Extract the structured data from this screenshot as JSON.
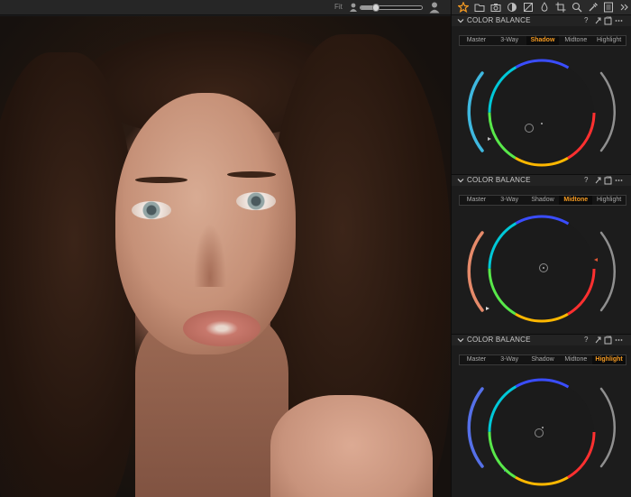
{
  "viewer": {
    "fit_label": "Fit",
    "zoom_level": 0.25,
    "photo": "portrait-woman-curly-hair"
  },
  "toolbar": {
    "icons": [
      "star-icon",
      "folder-icon",
      "camera-icon",
      "circle-half-icon",
      "exposure-icon",
      "crop-icon",
      "search-icon",
      "pipette-icon",
      "list-icon",
      "more-icon"
    ]
  },
  "color_balance_panels": [
    {
      "title": "COLOR BALANCE",
      "tabs": [
        "Master",
        "3-Way",
        "Shadow",
        "Midtone",
        "Highlight"
      ],
      "active_tab": "Shadow",
      "lightness_level": 0.15,
      "handle_offset": [
        0.0,
        0.0
      ]
    },
    {
      "title": "COLOR BALANCE",
      "tabs": [
        "Master",
        "3-Way",
        "Shadow",
        "Midtone",
        "Highlight"
      ],
      "active_tab": "Midtone",
      "lightness_level": 0.1,
      "handle_offset": [
        0.0,
        0.0
      ]
    },
    {
      "title": "COLOR BALANCE",
      "tabs": [
        "Master",
        "3-Way",
        "Shadow",
        "Midtone",
        "Highlight"
      ],
      "active_tab": "Highlight",
      "lightness_level": 0.12,
      "handle_offset": [
        0.0,
        0.0
      ]
    }
  ],
  "header_icons": [
    "help-icon",
    "reset-icon",
    "copy-icon",
    "menu-icon"
  ],
  "colors": {
    "accent": "#f49a22",
    "panel_bg": "#1c1c1c",
    "header_bg": "#232323"
  }
}
